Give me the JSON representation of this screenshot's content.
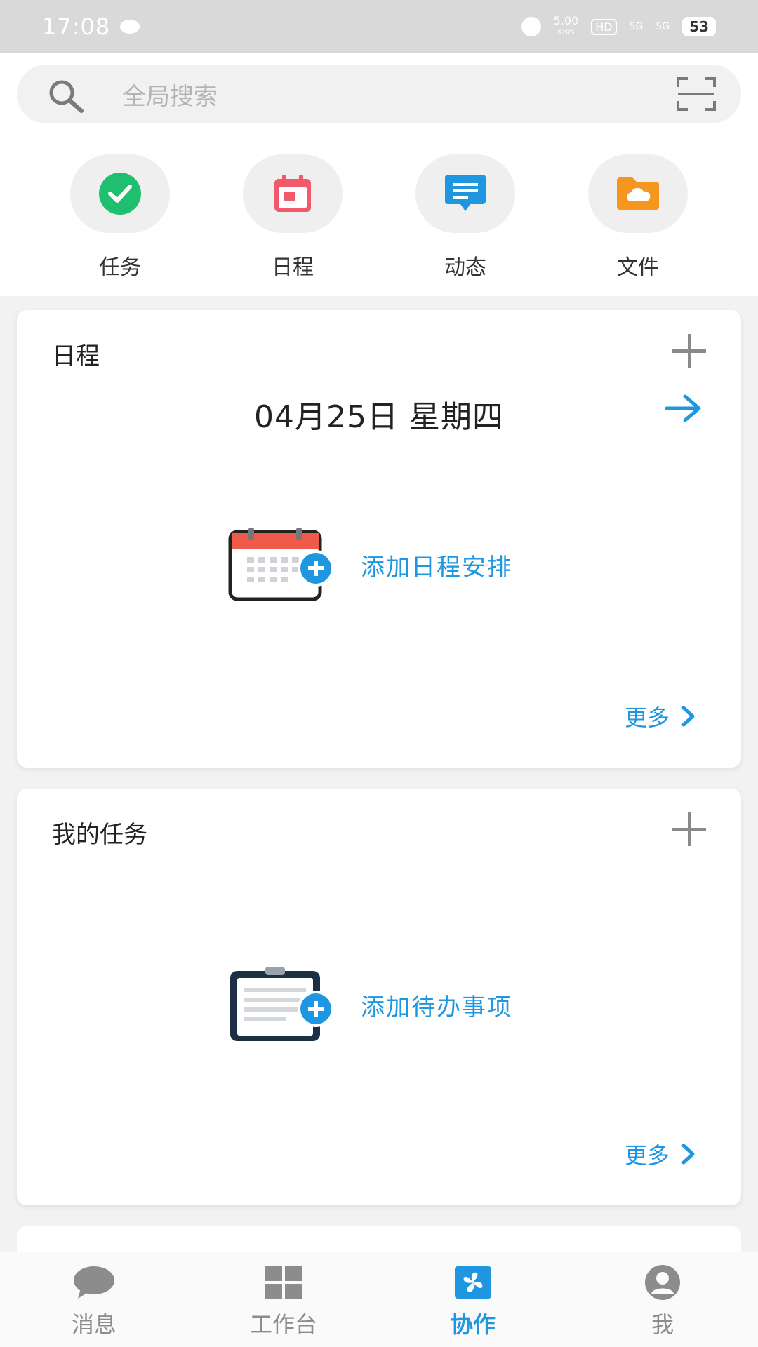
{
  "status_bar": {
    "time": "17:08",
    "net_speed": "5.00",
    "net_unit": "KB/s",
    "hd": "HD",
    "sig1": "5G",
    "sig2": "5G",
    "battery": "53"
  },
  "search": {
    "placeholder": "全局搜索"
  },
  "quick_actions": [
    {
      "label": "任务",
      "icon": "task-check-icon",
      "color": "#1fbf70"
    },
    {
      "label": "日程",
      "icon": "calendar-icon",
      "color": "#f05a6b"
    },
    {
      "label": "动态",
      "icon": "message-icon",
      "color": "#1e96e0"
    },
    {
      "label": "文件",
      "icon": "cloud-folder-icon",
      "color": "#f5961f"
    }
  ],
  "schedule_card": {
    "title": "日程",
    "date": "04月25日 星期四",
    "add_text": "添加日程安排",
    "more": "更多"
  },
  "tasks_card": {
    "title": "我的任务",
    "add_text": "添加待办事项",
    "more": "更多"
  },
  "tabs": [
    {
      "label": "消息",
      "icon": "chat-bubble-icon",
      "active": false
    },
    {
      "label": "工作台",
      "icon": "grid-icon",
      "active": false
    },
    {
      "label": "协作",
      "icon": "pinwheel-icon",
      "active": true
    },
    {
      "label": "我",
      "icon": "user-icon",
      "active": false
    }
  ],
  "colors": {
    "accent": "#1e96e0",
    "inactive": "#8c8c8c"
  }
}
